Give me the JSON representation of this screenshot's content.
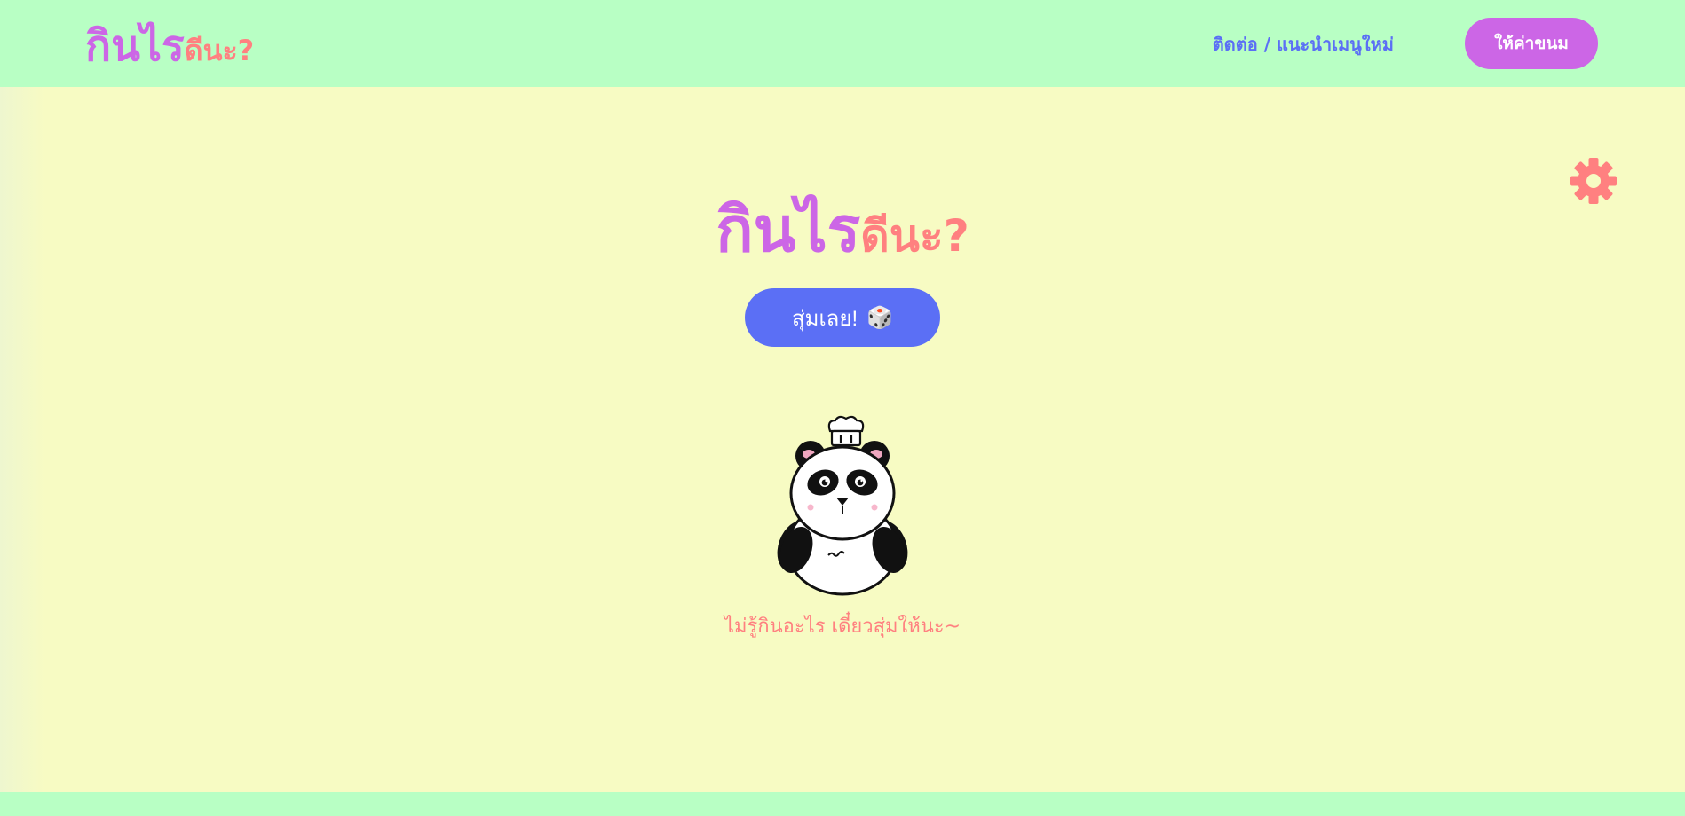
{
  "navbar": {
    "logo_main": "กินไร",
    "logo_sub": "ดีนะ?",
    "contact_link": "ติดต่อ / แนะนำเมนูใหม่",
    "donate_button": "ให้ค่าขนม"
  },
  "hero": {
    "title_main": "กินไร",
    "title_sub": "ดีนะ?",
    "random_button": "สุ่มเลย!",
    "random_button_icon": "🎲",
    "hint": "ไม่รู้กินอะไร เดี๋ยวสุ่มให้นะ~"
  },
  "icons": {
    "settings": "gear-icon",
    "dice": "dice-icon",
    "mascot": "panda-chef-mascot"
  },
  "colors": {
    "nav_bg": "#b8ffc4",
    "page_bg": "#f7fbc3",
    "purple": "#cc66e6",
    "coral": "#ff8080",
    "blue": "#5b6ff5"
  }
}
